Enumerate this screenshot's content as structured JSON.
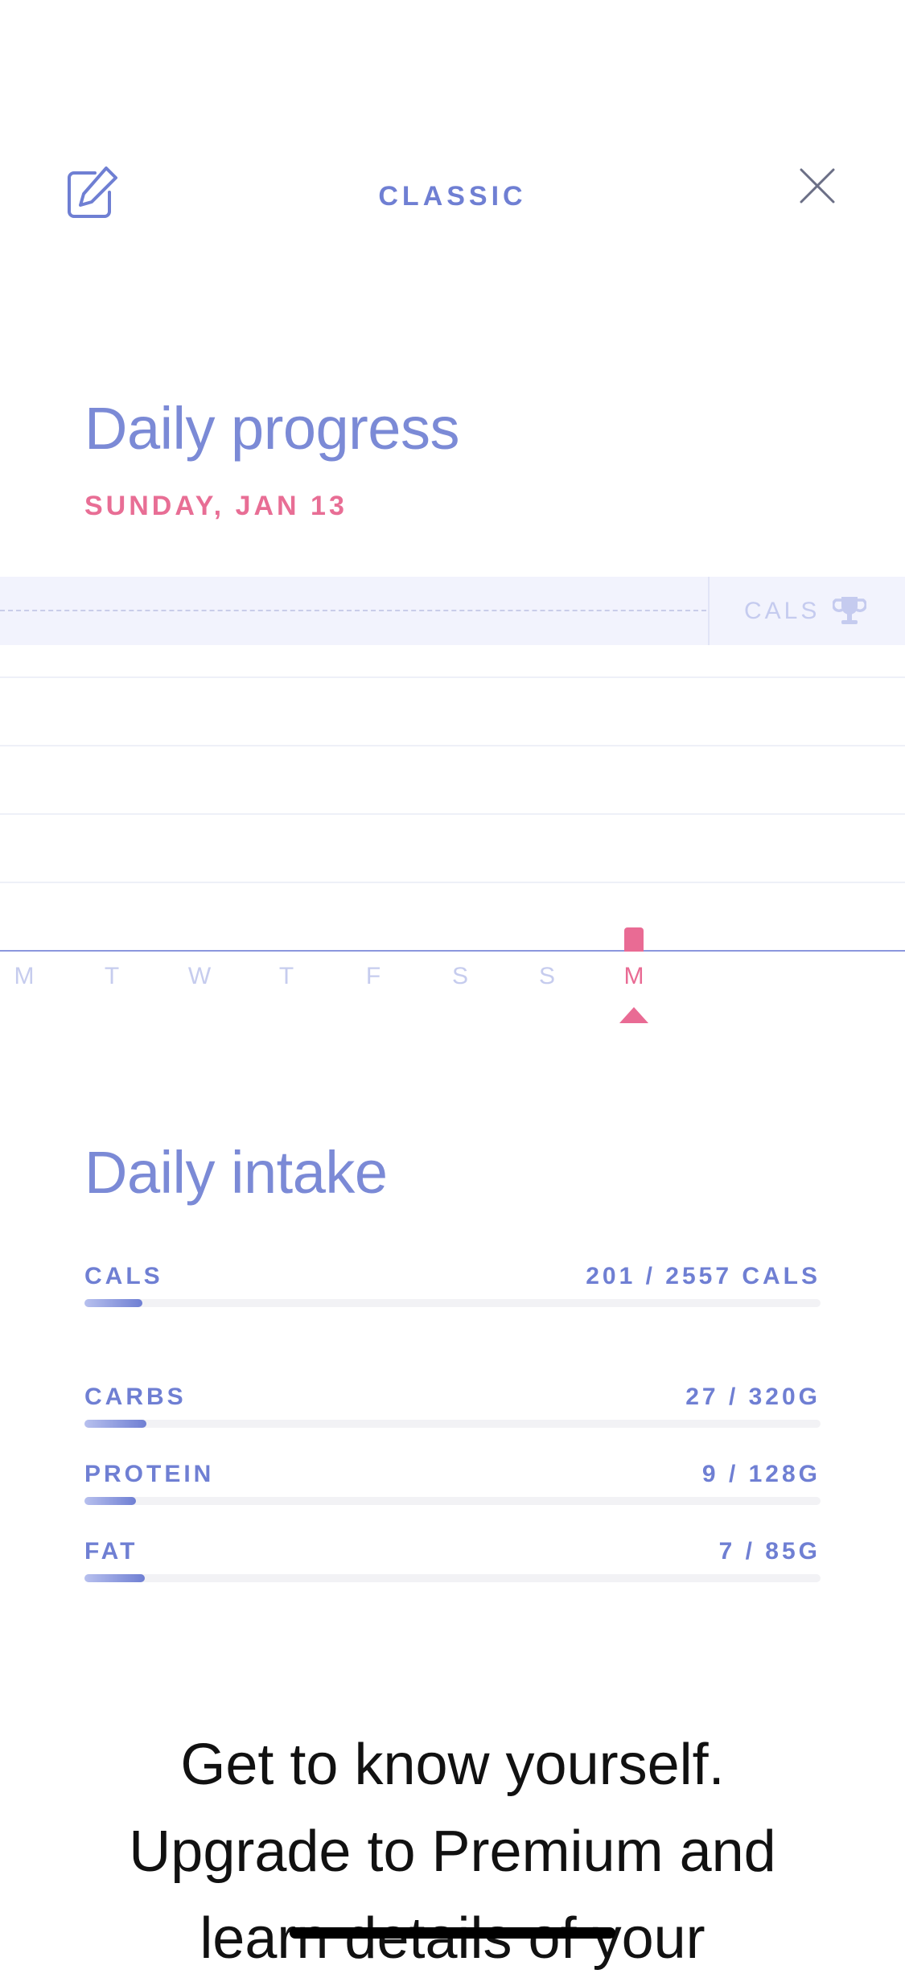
{
  "header": {
    "title": "CLASSIC",
    "edit_icon": "edit-icon",
    "close_icon": "close-icon"
  },
  "progress": {
    "heading": "Daily progress",
    "date": "SUNDAY, JAN 13",
    "goal_label": "CALS",
    "goal_icon": "trophy-icon",
    "days": [
      "M",
      "T",
      "W",
      "T",
      "F",
      "S",
      "S",
      "M"
    ],
    "selected_day_index": 7
  },
  "intake": {
    "heading": "Daily intake",
    "items": [
      {
        "label": "CALS",
        "value": "201 / 2557 CALS",
        "fraction": 0.079
      },
      {
        "label": "CARBS",
        "value": "27 / 320G",
        "fraction": 0.084
      },
      {
        "label": "PROTEIN",
        "value": "9 / 128G",
        "fraction": 0.07
      },
      {
        "label": "FAT",
        "value": "7 / 85G",
        "fraction": 0.082
      }
    ]
  },
  "promo": {
    "line1": "Get to know yourself.",
    "line2": "Upgrade to Premium and",
    "line3": "learn details of your"
  },
  "colors": {
    "accent": "#6f7fd3",
    "highlight": "#e96b94"
  }
}
